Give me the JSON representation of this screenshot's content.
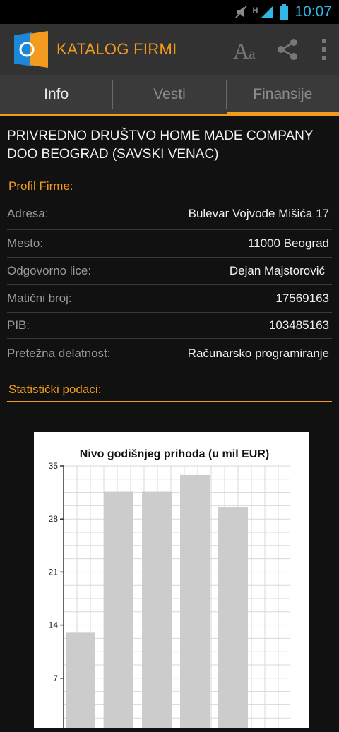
{
  "status_bar": {
    "time": "10:07",
    "network": "H"
  },
  "action_bar": {
    "title": "KATALOG FIRMI",
    "icons": [
      "text-size-icon",
      "share-icon",
      "overflow-menu-icon"
    ]
  },
  "tabs": [
    {
      "label": "Info"
    },
    {
      "label": "Vesti"
    },
    {
      "label": "Finansije"
    }
  ],
  "company": {
    "name": "PRIVREDNO DRUŠTVO HOME MADE COMPANY DOO BEOGRAD (SAVSKI VENAC)"
  },
  "profile": {
    "header": "Profil Firme:",
    "rows": [
      {
        "label": "Adresa:",
        "value": "Bulevar Vojvode Mišića 17"
      },
      {
        "label": "Mesto:",
        "value": "11000 Beograd"
      },
      {
        "label": "Odgovorno lice:",
        "value": "Dejan Majstorović"
      },
      {
        "label": "Matični broj:",
        "value": "17569163"
      },
      {
        "label": "PIB:",
        "value": "103485163"
      },
      {
        "label": "Pretežna delatnost:",
        "value": "Računarsko programiranje"
      }
    ]
  },
  "stats": {
    "header": "Statistički podaci:"
  },
  "chart_data": {
    "type": "bar",
    "title": "Nivo godišnjeg prihoda (u mil EUR)",
    "values": [
      13,
      31.6,
      31.6,
      33.8,
      29.6
    ],
    "ylim": [
      0,
      35
    ],
    "yticks": [
      "7",
      "14",
      "21",
      "28",
      "35"
    ],
    "grid": true,
    "bar_color": "#cccccc"
  },
  "colors": {
    "accent": "#f39b1e",
    "status_time": "#33b5e5"
  }
}
